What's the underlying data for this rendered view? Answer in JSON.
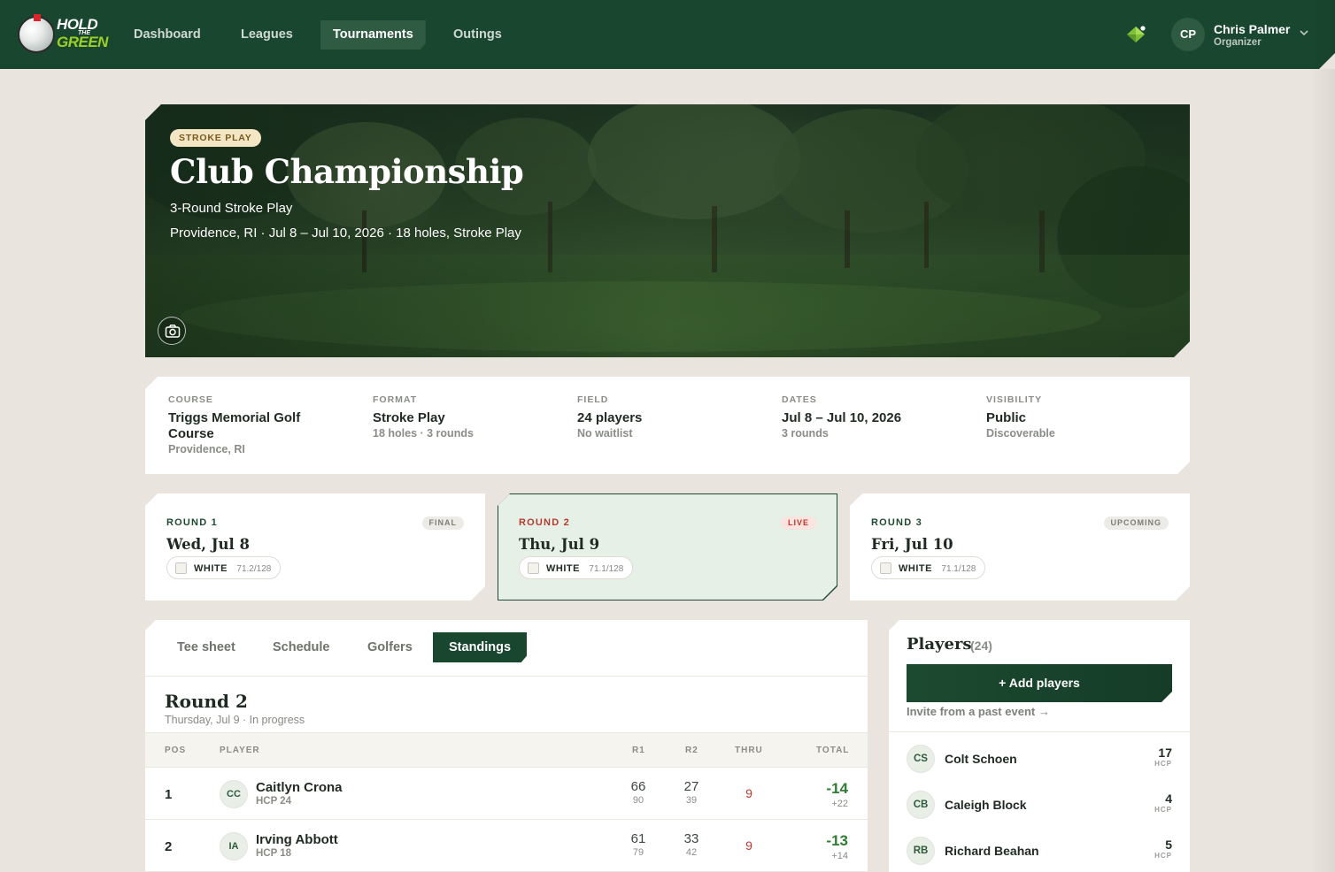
{
  "app": {
    "logo": {
      "line1": "HOLD",
      "line2": "THE",
      "line3": "GREEN"
    },
    "nav": [
      {
        "label": "Dashboard",
        "active": false
      },
      {
        "label": "Leagues",
        "active": false
      },
      {
        "label": "Tournaments",
        "active": true
      },
      {
        "label": "Outings",
        "active": false
      }
    ],
    "user": {
      "initials": "CP",
      "name": "Chris Palmer",
      "role": "Organizer"
    }
  },
  "hero": {
    "badge": "STROKE PLAY",
    "title": "Club Championship",
    "subtitle": "3-Round Stroke Play",
    "meta": "Providence, RI · Jul 8 – Jul 10, 2026 · 18 holes, Stroke Play"
  },
  "info": {
    "course": {
      "label": "COURSE",
      "value": "Triggs Memorial Golf Course",
      "sub": "Providence, RI"
    },
    "format": {
      "label": "FORMAT",
      "value": "Stroke Play",
      "sub": "18 holes · 3 rounds"
    },
    "field": {
      "label": "FIELD",
      "value": "24 players",
      "sub": "No waitlist"
    },
    "dates": {
      "label": "DATES",
      "value": "Jul 8 – Jul 10, 2026",
      "sub": "3 rounds"
    },
    "visibility": {
      "label": "VISIBILITY",
      "value": "Public",
      "sub": "Discoverable"
    }
  },
  "rounds": [
    {
      "label": "ROUND 1",
      "date": "Wed, Jul 8",
      "status": "FINAL",
      "tee": "WHITE",
      "rating": "71.2/128"
    },
    {
      "label": "ROUND 2",
      "date": "Thu, Jul 9",
      "status": "LIVE",
      "tee": "WHITE",
      "rating": "71.1/128"
    },
    {
      "label": "ROUND 3",
      "date": "Fri, Jul 10",
      "status": "UPCOMING",
      "tee": "WHITE",
      "rating": "71.1/128"
    }
  ],
  "standings": {
    "tabs": [
      "Tee sheet",
      "Schedule",
      "Golfers",
      "Standings"
    ],
    "active_tab": "Standings",
    "title": "Round 2",
    "subtitle": "Thursday, Jul 9 · In progress",
    "columns": {
      "pos": "POS",
      "player": "PLAYER",
      "r1": "R1",
      "r2": "R2",
      "thru": "THRU",
      "total": "TOTAL"
    },
    "rows": [
      {
        "pos": "1",
        "initials": "CC",
        "name": "Caitlyn Crona",
        "hcp": "HCP 24",
        "r1": "66",
        "r1_gross": "90",
        "r2": "27",
        "r2_gross": "39",
        "thru": "9",
        "total": "-14",
        "total_gross": "+22"
      },
      {
        "pos": "2",
        "initials": "IA",
        "name": "Irving Abbott",
        "hcp": "HCP 18",
        "r1": "61",
        "r1_gross": "79",
        "r2": "33",
        "r2_gross": "42",
        "thru": "9",
        "total": "-13",
        "total_gross": "+14"
      }
    ]
  },
  "players": {
    "title": "Players",
    "count": "(24)",
    "add_label": "+ Add players",
    "invite_label": "Invite from a past event →",
    "hcp_label": "HCP",
    "list": [
      {
        "initials": "CS",
        "name": "Colt Schoen",
        "hcp": "17"
      },
      {
        "initials": "CB",
        "name": "Caleigh Block",
        "hcp": "4"
      },
      {
        "initials": "RB",
        "name": "Richard Beahan",
        "hcp": "5"
      }
    ]
  }
}
